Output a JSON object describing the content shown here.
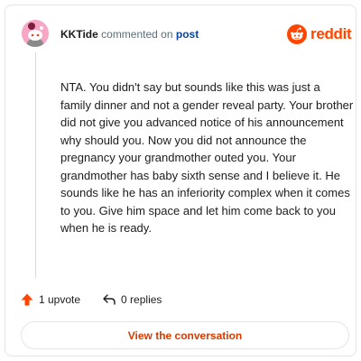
{
  "header": {
    "username": "KKTide",
    "action_text": "commented on",
    "post_link": "post"
  },
  "logo": {
    "wordmark": "reddit",
    "brand_color": "#ff4500"
  },
  "comment": {
    "text": "NTA. You didn't say but sounds like this was just a family dinner and not a gender reveal party. Your brother did not give you advanced notice of his announcement why should you. Now you did not announce the pregnancy your grandmother outed you. Your grandmother has baby sixth sense and I believe it. He sounds like he has an inferiority complex when it comes to you. Give him space and let him come back to you when he is ready."
  },
  "actions": {
    "upvotes": "1 upvote",
    "replies": "0 replies",
    "upvote_icon": "upvote-arrow-icon",
    "reply_icon": "reply-arrow-icon"
  },
  "cta": {
    "label": "View the conversation",
    "color": "#d93a00"
  }
}
